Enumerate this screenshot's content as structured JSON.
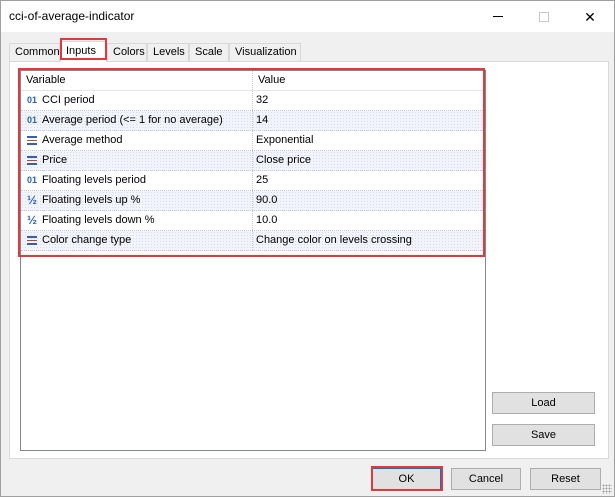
{
  "window": {
    "title": "cci-of-average-indicator",
    "controls": {
      "minimize": "—",
      "maximize": "",
      "close": "✕"
    }
  },
  "tabs": [
    {
      "label": "Common",
      "active": false
    },
    {
      "label": "Inputs",
      "active": true
    },
    {
      "label": "Colors",
      "active": false
    },
    {
      "label": "Levels",
      "active": false
    },
    {
      "label": "Scale",
      "active": false
    },
    {
      "label": "Visualization",
      "active": false
    }
  ],
  "table": {
    "headers": {
      "variable": "Variable",
      "value": "Value"
    },
    "rows": [
      {
        "icon": "integer-icon",
        "icon_text": "01",
        "variable": "CCI period",
        "value": "32"
      },
      {
        "icon": "integer-icon",
        "icon_text": "01",
        "variable": "Average period (<= 1 for no average)",
        "value": "14"
      },
      {
        "icon": "enum-icon",
        "icon_text": "",
        "variable": "Average method",
        "value": "Exponential"
      },
      {
        "icon": "enum-icon",
        "icon_text": "",
        "variable": "Price",
        "value": "Close price"
      },
      {
        "icon": "integer-icon",
        "icon_text": "01",
        "variable": "Floating levels period",
        "value": "25"
      },
      {
        "icon": "fraction-icon",
        "icon_text": "½",
        "variable": "Floating levels up %",
        "value": "90.0"
      },
      {
        "icon": "fraction-icon",
        "icon_text": "½",
        "variable": "Floating levels down %",
        "value": "10.0"
      },
      {
        "icon": "enum-icon",
        "icon_text": "",
        "variable": "Color change type",
        "value": "Change color on levels crossing"
      }
    ]
  },
  "side_buttons": {
    "load": "Load",
    "save": "Save"
  },
  "footer_buttons": {
    "ok": "OK",
    "cancel": "Cancel",
    "reset": "Reset"
  },
  "colors": {
    "highlight": "#e0393e",
    "icon_blue": "#2a62b8",
    "focus_border": "#0078d7"
  }
}
